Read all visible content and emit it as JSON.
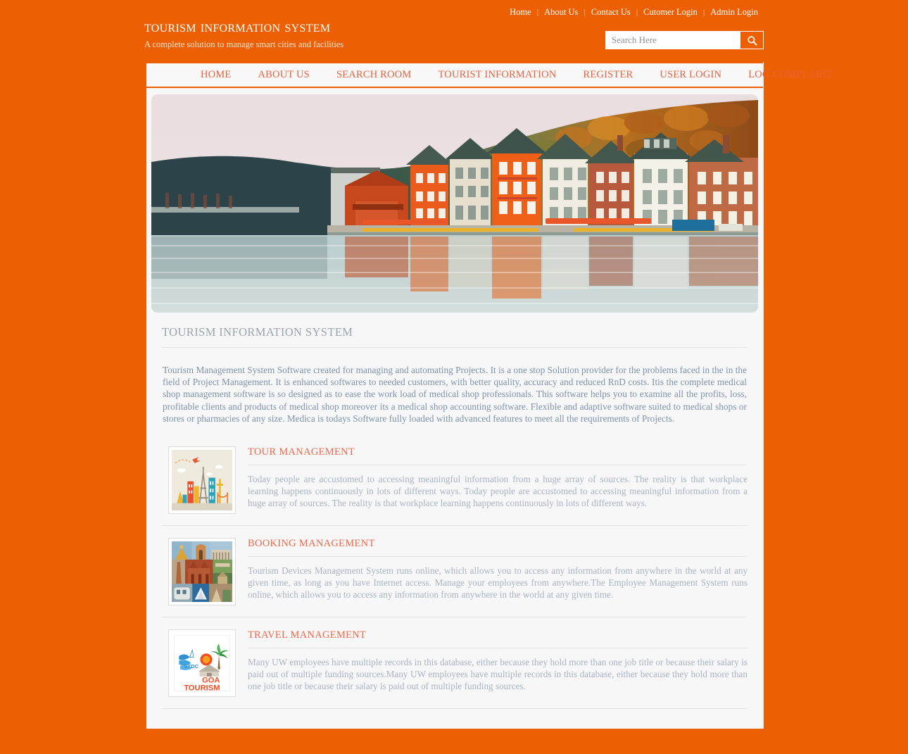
{
  "topbar": {
    "links": [
      "Home",
      "About Us",
      "Contact Us",
      "Cutomer Login",
      "Admin Login"
    ],
    "separator": "|"
  },
  "brand": {
    "title": "Tourism Information System",
    "subtitle": "A complete solution to manage smart cities and facilities"
  },
  "search": {
    "placeholder": "Search Here",
    "value": "",
    "button_icon": "search-icon"
  },
  "nav": {
    "items": [
      "HOME",
      "ABOUT US",
      "SEARCH ROOM",
      "TOURIST INFORMATION",
      "REGISTER",
      "USER LOGIN",
      "LOG COMPLAINT"
    ]
  },
  "hero": {
    "alt": "Riverside European town with orange buildings and autumn hills reflected in water"
  },
  "main": {
    "section_title": "TOURISM INFORMATION SYSTEM",
    "intro": "Tourism Management System Software created for managing and automating Projects. It is a one stop Solution provider for the problems faced in the in the field of Project Management. It is enhanced softwares to needed customers, with better quality, accuracy and reduced RnD costs. Itis the complete medical shop management software is so designed as to ease the work load of medical shop professionals. This software helps you to examine all the profits, loss, profitable clients and products of medical shop moreover its a medical shop accounting software. Flexible and adaptive software suited to medical shops or stores or pharmacies of any size. Medica is todays Software fully loaded with advanced features to meet all the requirements of Projects.",
    "features": [
      {
        "title": "TOUR MANAGEMENT",
        "image": "world-landmarks-illustration",
        "text": "Today people are accustomed to accessing meaningful information from a huge array of sources. The reality is that workplace learning happens continuously in lots of different ways. Today people are accustomed to accessing meaningful information from a huge array of sources. The reality is that workplace learning happens continuously in lots of different ways."
      },
      {
        "title": "BOOKING MANAGEMENT",
        "image": "delhi-monuments-collage",
        "text": "Tourism Devices Management System runs online, which allows you to access any information from anywhere in the world at any given time, as long as you have Internet access. Manage your employees from anywhere.The Employee Management System runs online, which allows you to access any information from anywhere in the world at any given time."
      },
      {
        "title": "TRAVEL MANAGEMENT",
        "image": "goa-tourism-logo",
        "text": "Many UW employees have multiple records in this database, either because they hold more than one job title or because their salary is paid out of multiple funding sources.Many UW employees have multiple records in this database, either because they hold more than one job title or because their salary is paid out of multiple funding sources."
      }
    ]
  },
  "colors": {
    "brand_orange": "#ec6003",
    "heading_grey": "#9aa4b0",
    "feature_heading": "#f0674a",
    "body_text": "#7f93ad",
    "panel_bg": "#f7f7f7"
  }
}
